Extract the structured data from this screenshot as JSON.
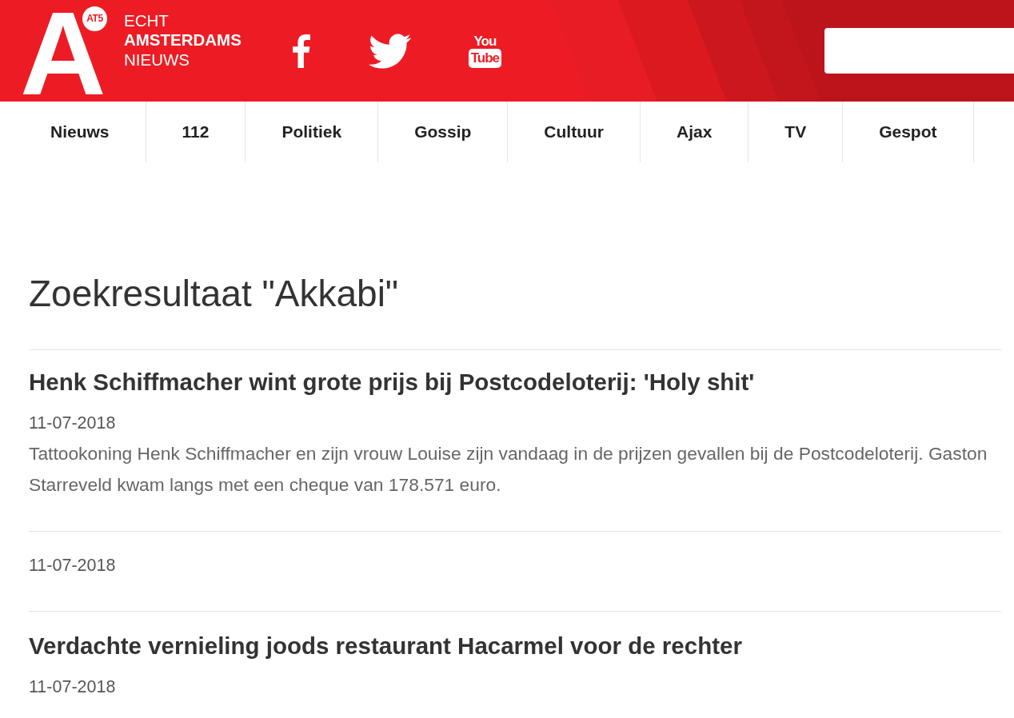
{
  "header": {
    "logo": {
      "letter": "A",
      "badge": "AT5",
      "tagline": [
        {
          "text": "ECHT",
          "bold": false
        },
        {
          "text": "AMSTERDAMS",
          "bold": true
        },
        {
          "text": "NIEUWS",
          "bold": false
        }
      ]
    },
    "social": [
      {
        "kind": "facebook"
      },
      {
        "kind": "twitter"
      },
      {
        "kind": "youtube",
        "top": "You",
        "bottom": "Tube"
      }
    ]
  },
  "nav": [
    {
      "label": "Nieuws"
    },
    {
      "label": "112"
    },
    {
      "label": "Politiek"
    },
    {
      "label": "Gossip"
    },
    {
      "label": "Cultuur"
    },
    {
      "label": "Ajax"
    },
    {
      "label": "TV"
    },
    {
      "label": "Gespot"
    }
  ],
  "heading": "Zoekresultaat \"Akkabi\"",
  "results": [
    {
      "title": "Henk Schiffmacher wint grote prijs bij Postcodeloterij: 'Holy shit'",
      "date": "11-07-2018",
      "summary": "Tattookoning Henk Schiffmacher en zijn vrouw Louise zijn vandaag in de prijzen gevallen bij de Postcodeloterij. Gaston Starreveld kwam langs met een cheque van 178.571 euro."
    },
    {
      "date": "11-07-2018"
    },
    {
      "title": "Verdachte vernieling joods restaurant Hacarmel voor de rechter",
      "date": "11-07-2018"
    }
  ]
}
